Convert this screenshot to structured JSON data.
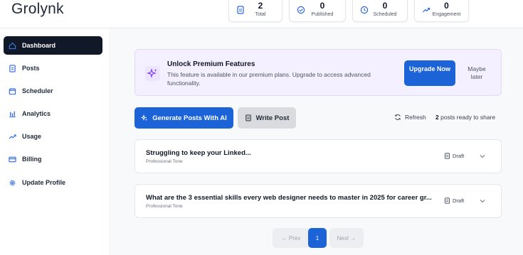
{
  "app": {
    "logo": "Grolynk"
  },
  "stats": [
    {
      "value": "2",
      "label": "Total",
      "icon": "document-icon"
    },
    {
      "value": "0",
      "label": "Published",
      "icon": "check-circle-icon"
    },
    {
      "value": "0",
      "label": "Scheduled",
      "icon": "clock-icon"
    },
    {
      "value": "0",
      "label": "Engagement",
      "icon": "trending-up-icon"
    }
  ],
  "sidebar": {
    "items": [
      {
        "label": "Dashboard",
        "icon": "home-icon",
        "active": true
      },
      {
        "label": "Posts",
        "icon": "document-icon"
      },
      {
        "label": "Scheduler",
        "icon": "calendar-icon"
      },
      {
        "label": "Analytics",
        "icon": "bar-chart-icon"
      },
      {
        "label": "Usage",
        "icon": "trending-up-icon"
      },
      {
        "label": "Billing",
        "icon": "credit-card-icon"
      },
      {
        "label": "Update Profile",
        "icon": "gear-icon"
      }
    ]
  },
  "promo": {
    "title": "Unlock Premium Features",
    "text": "This feature is available in our premium plans. Upgrade to access advanced functionality.",
    "upgrade_label": "Upgrade Now",
    "later_label": "Maybe later"
  },
  "actions": {
    "generate_label": "Generate Posts With AI",
    "write_label": "Write Post",
    "refresh_label": "Refresh",
    "ready_count": "2",
    "ready_text": "posts ready to share"
  },
  "posts": [
    {
      "title": "Struggling to keep your Linked...",
      "tone": "Professional Tone",
      "status": "Draft"
    },
    {
      "title": "What are the 3 essential skills every web designer needs to master in 2025 for career gr...",
      "tone": "Professional Tone",
      "status": "Draft"
    }
  ],
  "pagination": {
    "prev_label": "← Prev",
    "page": "1",
    "next_label": "Next →"
  },
  "colors": {
    "primary": "#1d63d8",
    "sidebar_active": "#111827",
    "promo_bg": "#f5f0ff"
  }
}
